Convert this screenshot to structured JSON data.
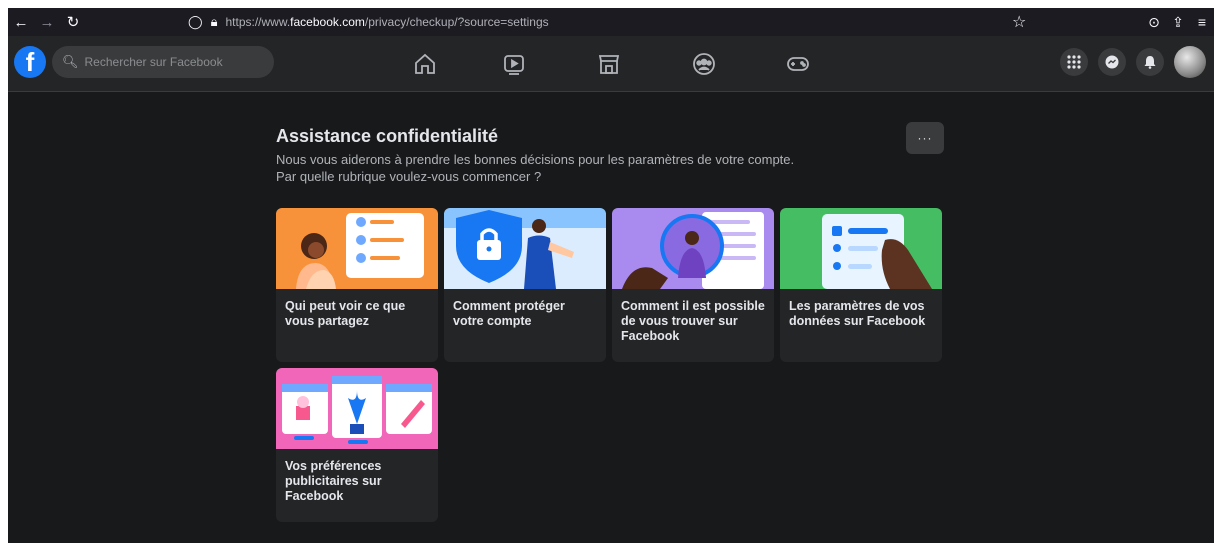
{
  "browser": {
    "back_icon": "arrow-left-icon",
    "forward_icon": "arrow-right-icon",
    "reload_icon": "reload-icon",
    "url_prefix": "https://www.",
    "url_host": "facebook.com",
    "url_path": "/privacy/checkup/?source=settings"
  },
  "header": {
    "logo": "f",
    "search_placeholder": "Rechercher sur Facebook",
    "nav_icons": [
      "home-icon",
      "video-icon",
      "marketplace-icon",
      "groups-icon",
      "gaming-icon"
    ]
  },
  "page": {
    "title": "Assistance confidentialité",
    "subtitle_line1": "Nous vous aiderons à prendre les bonnes décisions pour les paramètres de votre compte.",
    "subtitle_line2": "Par quelle rubrique voulez-vous commencer ?",
    "more_label": "···"
  },
  "cards": [
    {
      "label": "Qui peut voir ce que vous partagez",
      "color": "#f7923a"
    },
    {
      "label": "Comment protéger votre compte",
      "color": "#8ac4ff"
    },
    {
      "label": "Comment il est possible de vous trouver sur Facebook",
      "color": "#a98bf0"
    },
    {
      "label": "Les paramètres de vos données sur Facebook",
      "color": "#45bd62"
    },
    {
      "label": "Vos préférences publicitaires sur Facebook",
      "color": "#f266ba"
    }
  ]
}
